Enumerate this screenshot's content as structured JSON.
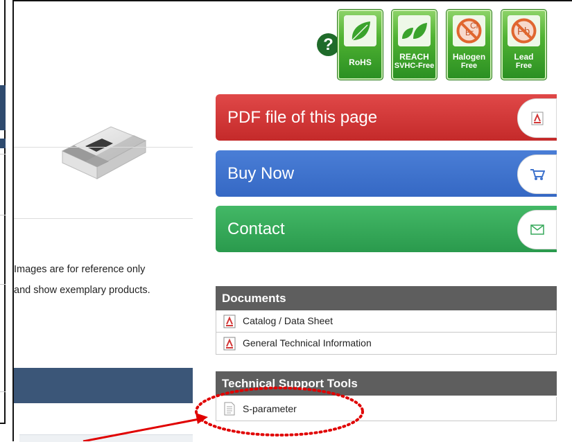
{
  "badges": [
    {
      "line1": "RoHS",
      "line2": ""
    },
    {
      "line1": "REACH",
      "line2": "SVHC-Free"
    },
    {
      "line1": "Halogen",
      "line2": "Free",
      "symbol": "BrCl"
    },
    {
      "line1": "Lead",
      "line2": "Free",
      "symbol": "Pb"
    }
  ],
  "help": {
    "label": "?"
  },
  "actions": {
    "pdf_label": "PDF file of this page",
    "buy_label": "Buy Now",
    "contact_label": "Contact"
  },
  "caption": {
    "line1": "Images are for reference only",
    "line2": "and show exemplary products."
  },
  "documents": {
    "title": "Documents",
    "items": [
      "Catalog / Data Sheet",
      "General Technical Information"
    ]
  },
  "tools": {
    "title": "Technical Support Tools",
    "items": [
      "S-parameter"
    ]
  },
  "colors": {
    "pdf": "#d23636",
    "buy": "#3f73cd",
    "contact": "#36a95a",
    "badge_green": "#3fa42a",
    "panel_header": "#5e5e5e",
    "annotation": "#e00000"
  },
  "icons": {
    "pdf_tab": "pdf-icon",
    "buy_tab": "cart-icon",
    "contact_tab": "envelope-icon",
    "doc_item": "pdf-file-icon",
    "tool_item": "text-file-icon"
  }
}
